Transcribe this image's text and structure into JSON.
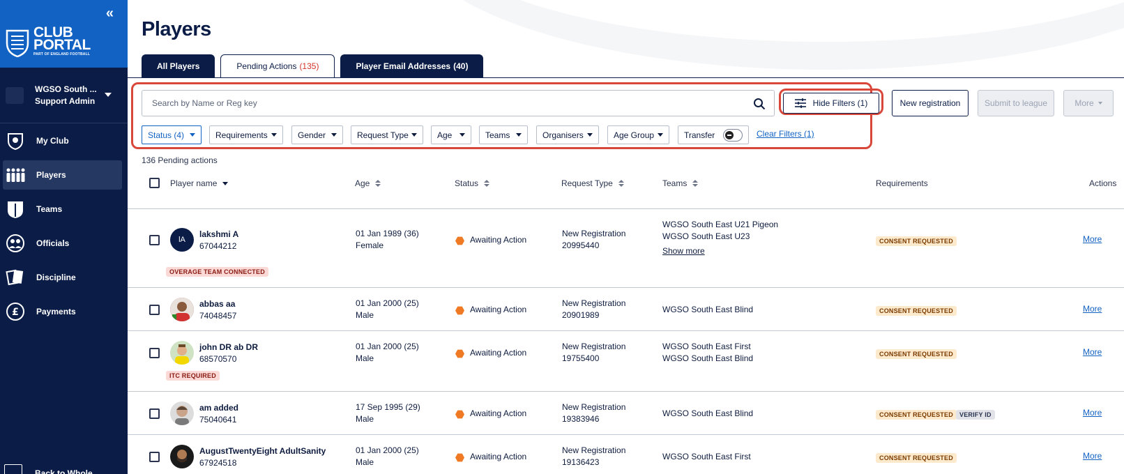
{
  "sidebar": {
    "brand": {
      "line1": "CLUB",
      "line2": "PORTAL",
      "sub": "PART OF ENGLAND FOOTBALL"
    },
    "org": {
      "name": "WGSO South ...",
      "role": "Support Admin"
    },
    "items": [
      {
        "label": "My Club",
        "icon": "shield-icon"
      },
      {
        "label": "Players",
        "icon": "players-icon"
      },
      {
        "label": "Teams",
        "icon": "shirt-icon"
      },
      {
        "label": "Officials",
        "icon": "officials-icon"
      },
      {
        "label": "Discipline",
        "icon": "cards-icon"
      },
      {
        "label": "Payments",
        "icon": "pound-icon"
      }
    ],
    "back_label": "Back to Whole"
  },
  "page": {
    "title": "Players"
  },
  "tabs": [
    {
      "label": "All Players",
      "count": ""
    },
    {
      "label": "Pending Actions",
      "count": "(135)"
    },
    {
      "label": "Player Email Addresses",
      "count": "(40)"
    }
  ],
  "search": {
    "placeholder": "Search by Name or Reg key",
    "value": ""
  },
  "toolbar": {
    "hide_filters": "Hide Filters (1)",
    "new_registration": "New registration",
    "submit_to_league": "Submit to league",
    "more": "More"
  },
  "filters": {
    "chips": [
      "Status (4)",
      "Requirements",
      "Gender",
      "Request Type",
      "Age",
      "Teams",
      "Organisers",
      "Age Group"
    ],
    "transfer": "Transfer",
    "clear": "Clear Filters (1)"
  },
  "pending_count": "136 Pending actions",
  "table": {
    "headers": [
      "Player name",
      "Age",
      "Status",
      "Request Type",
      "Teams",
      "Requirements",
      "Actions"
    ],
    "rows": [
      {
        "initials": "lA",
        "name": "lakshmi A",
        "reg": "67044212",
        "dob": "01 Jan 1989 (36)",
        "gender": "Female",
        "status": "Awaiting Action",
        "request": "New Registration",
        "request_id": "20995440",
        "team1": "WGSO South East U21 Pigeon",
        "team2": "WGSO South East U23",
        "show_more": "Show more",
        "req1": "CONSENT REQUESTED",
        "req2": "",
        "flag": "OVERAGE TEAM CONNECTED",
        "action": "More"
      },
      {
        "initials": "",
        "name": "abbas aa",
        "reg": "74048457",
        "dob": "01 Jan 2000 (25)",
        "gender": "Male",
        "status": "Awaiting Action",
        "request": "New Registration",
        "request_id": "20901989",
        "team1": "WGSO South East Blind",
        "team2": "",
        "show_more": "",
        "req1": "CONSENT REQUESTED",
        "req2": "",
        "flag": "",
        "action": "More"
      },
      {
        "initials": "",
        "name": "john DR ab DR",
        "reg": "68570570",
        "dob": "01 Jan 2000 (25)",
        "gender": "Male",
        "status": "Awaiting Action",
        "request": "New Registration",
        "request_id": "19755400",
        "team1": "WGSO South East First",
        "team2": "WGSO South East Blind",
        "show_more": "",
        "req1": "CONSENT REQUESTED",
        "req2": "",
        "flag": "ITC REQUIRED",
        "action": "More"
      },
      {
        "initials": "",
        "name": "am added",
        "reg": "75040641",
        "dob": "17 Sep 1995 (29)",
        "gender": "Male",
        "status": "Awaiting Action",
        "request": "New Registration",
        "request_id": "19383946",
        "team1": "WGSO South East Blind",
        "team2": "",
        "show_more": "",
        "req1": "CONSENT REQUESTED",
        "req2": "VERIFY ID",
        "flag": "",
        "action": "More"
      },
      {
        "initials": "",
        "name": "AugustTwentyEight AdultSanity",
        "reg": "67924518",
        "dob": "01 Jan 2000 (25)",
        "gender": "Male",
        "status": "Awaiting Action",
        "request": "New Registration",
        "request_id": "19136423",
        "team1": "WGSO South East First",
        "team2": "",
        "show_more": "",
        "req1": "CONSENT REQUESTED",
        "req2": "",
        "flag": "",
        "action": "More"
      }
    ]
  },
  "colors": {
    "navy": "#0b1d47",
    "brand_blue": "#1262c4",
    "highlight": "#d9473b",
    "status_orange": "#f07a24"
  }
}
